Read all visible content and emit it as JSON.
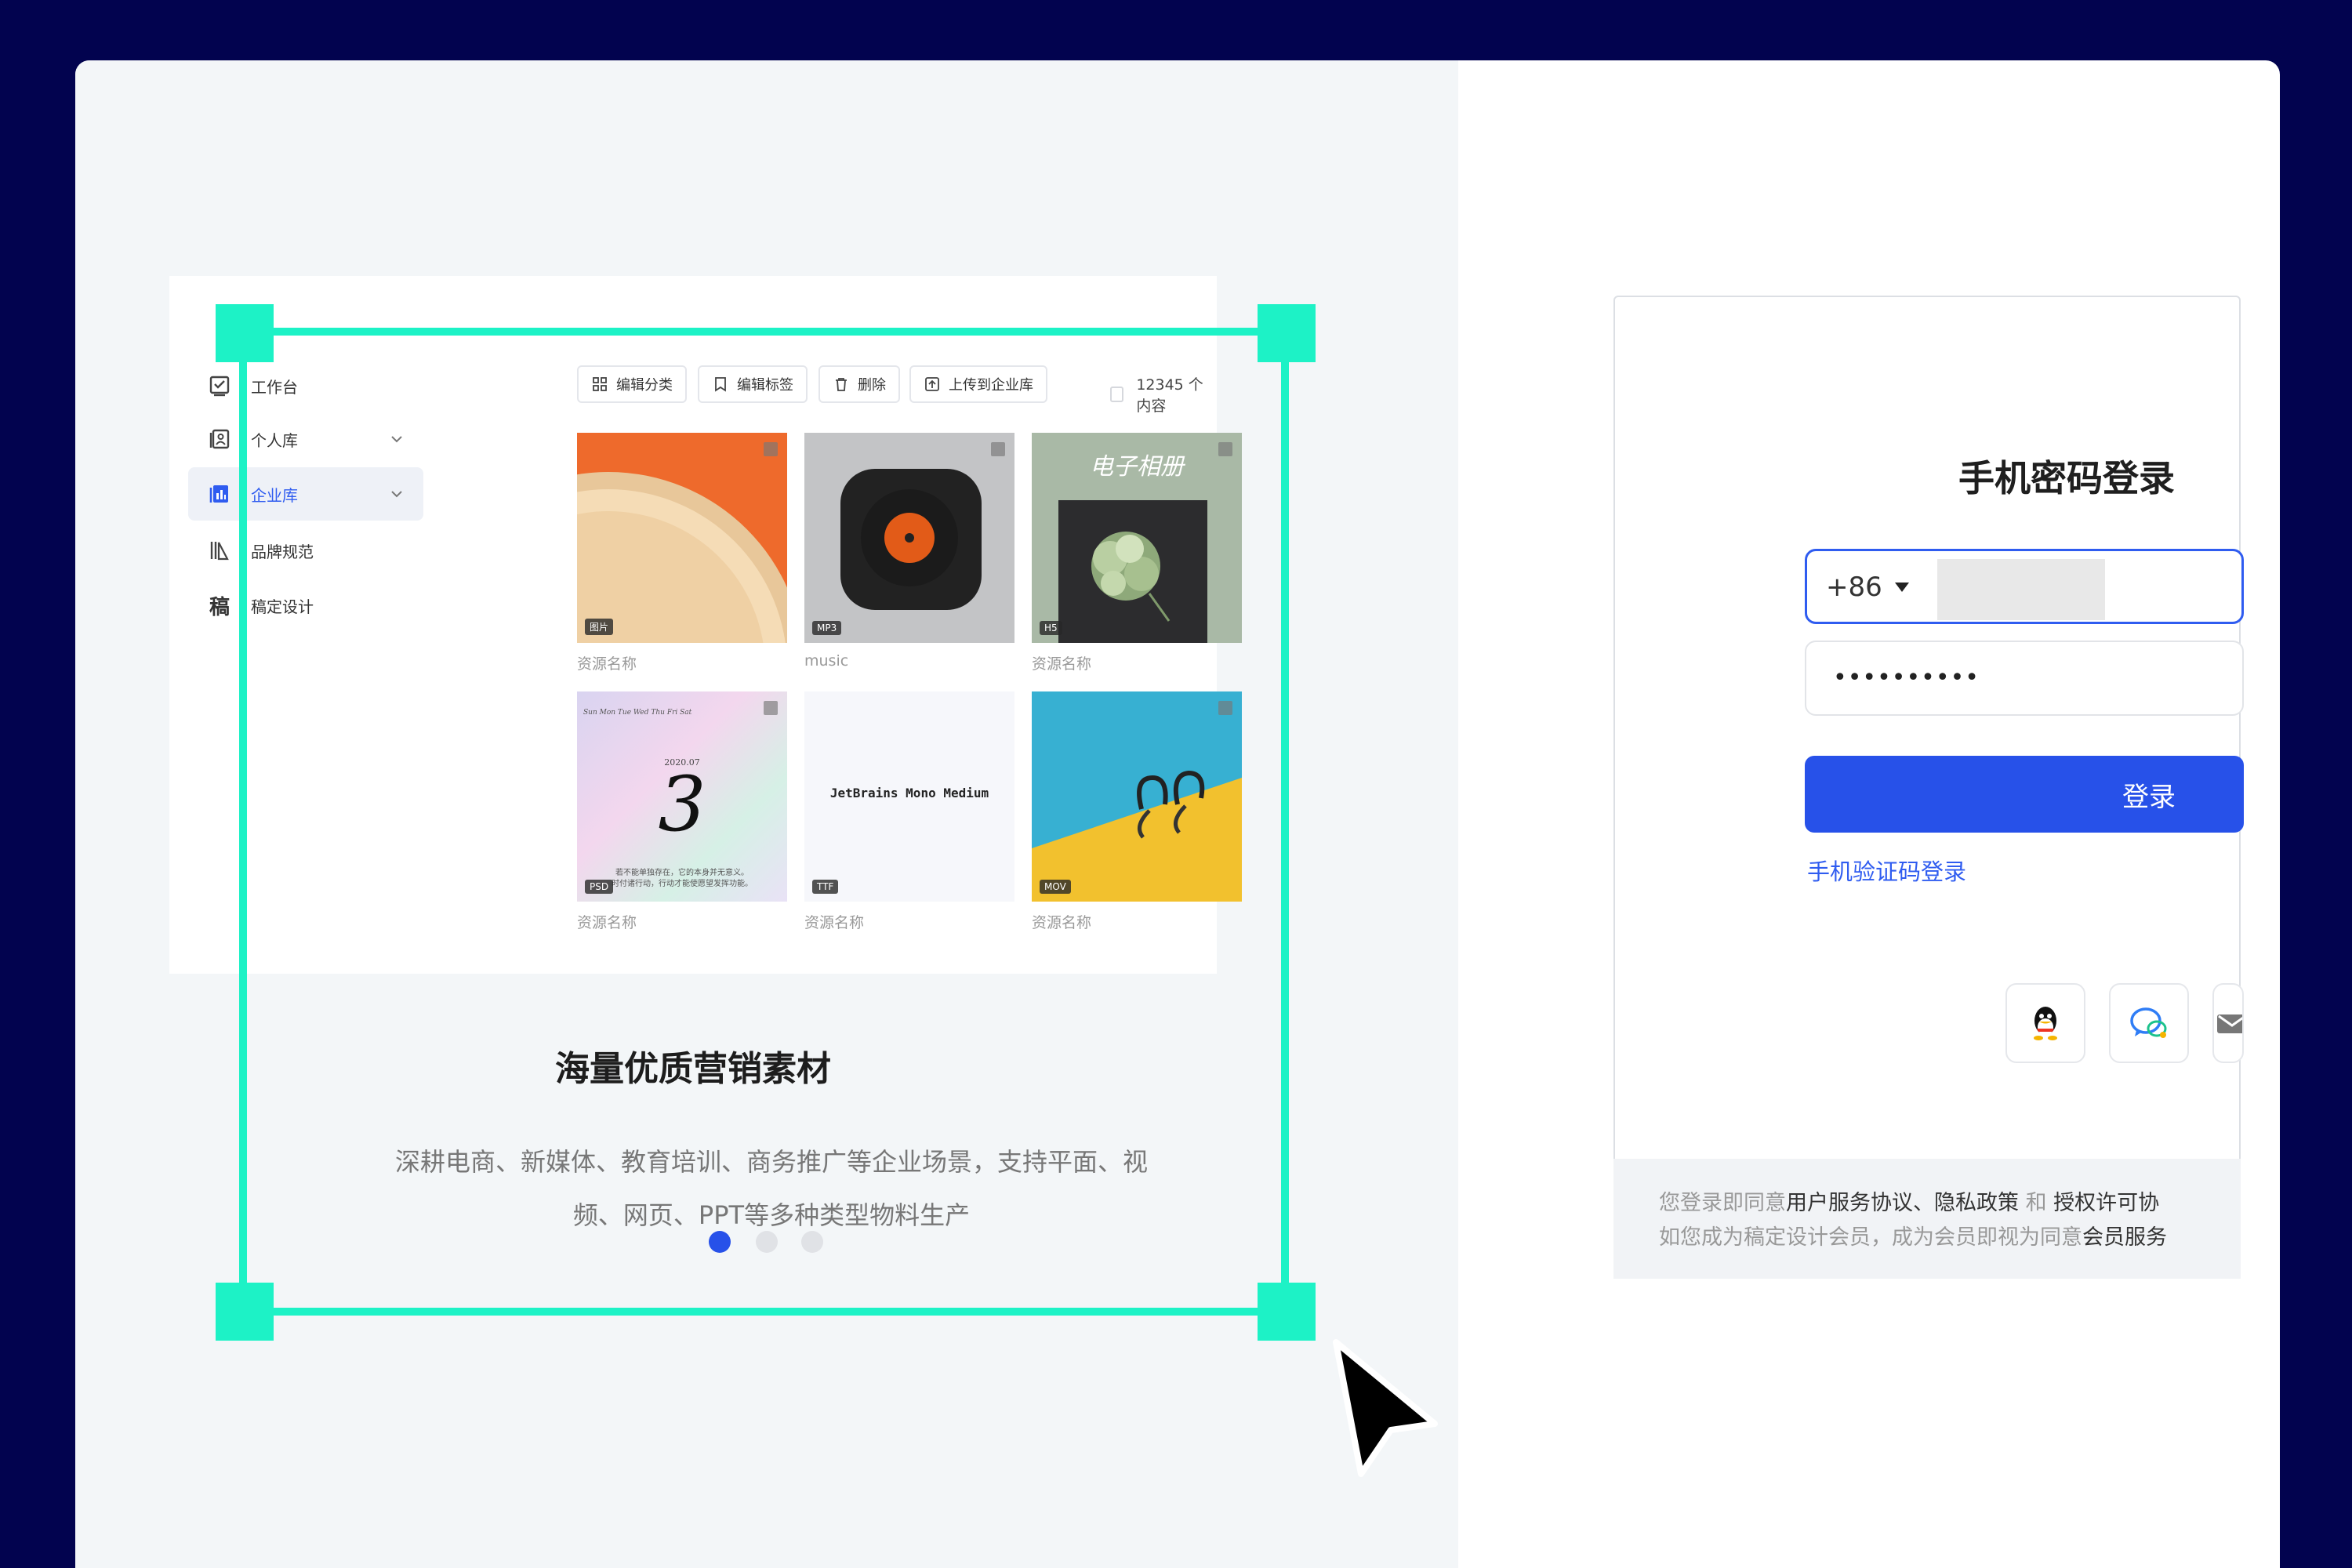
{
  "preview": {
    "sidebar": [
      {
        "label": "工作台",
        "icon": "workbench-icon"
      },
      {
        "label": "个人库",
        "icon": "personal-library-icon"
      },
      {
        "label": "企业库",
        "icon": "enterprise-library-icon"
      },
      {
        "label": "品牌规范",
        "icon": "brand-guide-icon"
      },
      {
        "label": "稿定设计",
        "icon": "gaoding-icon"
      }
    ],
    "toolbar": {
      "edit_category": "编辑分类",
      "edit_tags": "编辑标签",
      "delete": "删除",
      "upload": "上传到企业库",
      "count": "12345 个内容"
    },
    "tiles": [
      {
        "badge": "图片",
        "name": "资源名称"
      },
      {
        "badge": "MP3",
        "name": "music"
      },
      {
        "badge": "H5",
        "name": "资源名称",
        "overlay": "电子相册"
      },
      {
        "badge": "PSD",
        "name": "资源名称",
        "calendar_days": "Sun  Mon  Tue  Wed  Thu  Fri  Sat",
        "calendar_date": "2020.07",
        "calendar_num": "3",
        "calendar_text1": "若不能单独存在，它的本身并无意义。",
        "calendar_text2": "时付诸行动，行动才能使愿望发挥功能。"
      },
      {
        "badge": "TTF",
        "name": "资源名称",
        "font_sample": "JetBrains Mono Medium"
      },
      {
        "badge": "MOV",
        "name": "资源名称"
      }
    ],
    "caption_title": "海量优质营销素材",
    "caption_line1": "深耕电商、新媒体、教育培训、商务推广等企业场景，支持平面、视",
    "caption_line2": "频、网页、PPT等多种类型物料生产",
    "dots_active": 0
  },
  "login": {
    "title": "手机密码登录",
    "country_code": "+86",
    "password_mask": "••••••••••",
    "login_button": "登录",
    "sms_login": "手机验证码登录",
    "social": [
      "qq-icon",
      "wechat-icon",
      "mail-icon"
    ],
    "agree1_a": "您登录即同意",
    "agree1_b": "用户服务协议、隐私政策",
    "agree1_c": " 和 ",
    "agree1_d": "授权许可协",
    "agree2_a": "如您成为稿定设计会员，成为会员即视为同意",
    "agree2_b": "会员服务"
  },
  "colors": {
    "background": "#02034f",
    "selection": "#1df2c6",
    "accent": "#2751e9"
  }
}
